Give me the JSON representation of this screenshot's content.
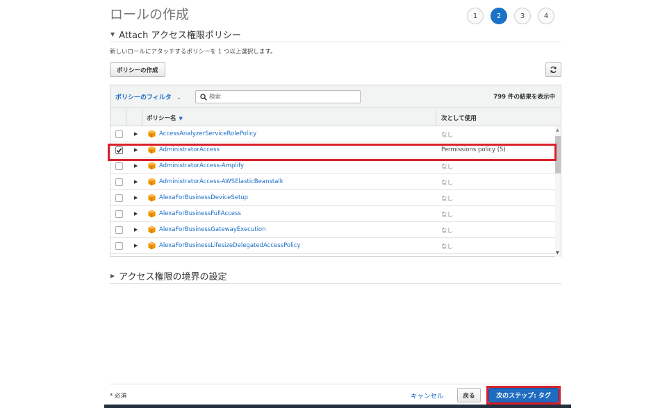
{
  "header": {
    "title": "ロールの作成",
    "steps": [
      "1",
      "2",
      "3",
      "4"
    ],
    "active_step": "2"
  },
  "attach_section": {
    "title": "Attach アクセス権限ポリシー",
    "instruction": "新しいロールにアタッチするポリシーを 1 つ以上選択します。",
    "create_policy_label": "ポリシーの作成"
  },
  "filter": {
    "label": "ポリシーのフィルタ",
    "search_placeholder": "検索",
    "result_count": "799 件の結果を表示中"
  },
  "table": {
    "col_policy_name": "ポリシー名",
    "col_used_as": "次として使用",
    "rows": [
      {
        "name": "AccessAnalyzerServiceRolePolicy",
        "used_as": "なし",
        "checked": false
      },
      {
        "name": "AdministratorAccess",
        "used_as": "Permissions policy (5)",
        "checked": true
      },
      {
        "name": "AdministratorAccess-Amplify",
        "used_as": "なし",
        "checked": false
      },
      {
        "name": "AdministratorAccess-AWSElasticBeanstalk",
        "used_as": "なし",
        "checked": false
      },
      {
        "name": "AlexaForBusinessDeviceSetup",
        "used_as": "なし",
        "checked": false
      },
      {
        "name": "AlexaForBusinessFullAccess",
        "used_as": "なし",
        "checked": false
      },
      {
        "name": "AlexaForBusinessGatewayExecution",
        "used_as": "なし",
        "checked": false
      },
      {
        "name": "AlexaForBusinessLifesizeDelegatedAccessPolicy",
        "used_as": "なし",
        "checked": false
      }
    ]
  },
  "boundary_section": {
    "title": "アクセス権限の境界の設定"
  },
  "footer": {
    "required_note": "* 必須",
    "cancel_label": "キャンセル",
    "back_label": "戻る",
    "next_label": "次のステップ: タグ"
  },
  "colors": {
    "link_blue": "#1a6cc6",
    "primary_button": "#1f6bbf",
    "highlight_red": "#d9202c",
    "policy_icon": "#f29100"
  },
  "icons": [
    "refresh-icon",
    "search-icon",
    "policy-cube-icon",
    "expand-arrow-icon",
    "checkmark-icon",
    "sort-down-icon"
  ]
}
